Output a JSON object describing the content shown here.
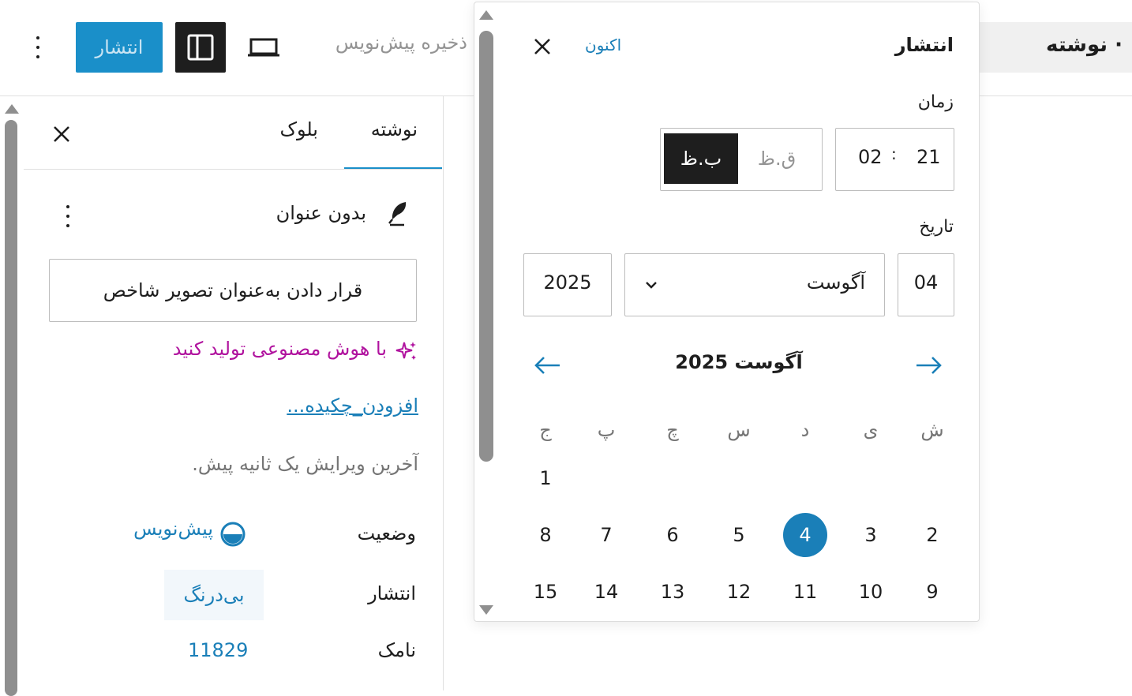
{
  "header": {
    "doc_label": "· نوشته",
    "save_draft": "ذخیره پیش‌نویس",
    "publish_button": "انتشار",
    "accent_color": "#1a8fc9"
  },
  "sidebar": {
    "tabs": [
      {
        "label": "نوشته",
        "active": true
      },
      {
        "label": "بلوک",
        "active": false
      }
    ],
    "post_title": "بدون عنوان",
    "featured_image_button": "قرار دادن به‌عنوان تصویر شاخص",
    "ai_generate_link": "با هوش مصنوعی تولید کنید",
    "ai_color": "#b0129e",
    "excerpt_link": "افزودن_چکیده...",
    "last_edited": "آخرین ویرایش یک ثانیه پیش.",
    "rows": {
      "status_label": "وضعیت",
      "status_value": "پیش‌نویس",
      "publish_label": "انتشار",
      "publish_value": "بی‌درنگ",
      "slug_label": "نامک",
      "slug_value": "11829"
    }
  },
  "popover": {
    "title": "انتشار",
    "now_link": "اکنون",
    "time_label": "زمان",
    "time": {
      "hour": "21",
      "minute": "02",
      "separator": ":"
    },
    "ampm": {
      "am": "ق.ظ",
      "pm": "ب.ظ",
      "selected": "pm"
    },
    "date_label": "تاریخ",
    "date": {
      "day": "04",
      "month": "آگوست",
      "year": "2025"
    },
    "calendar": {
      "heading": "آگوست 2025",
      "weekdays": [
        "ش",
        "ی",
        "د",
        "س",
        "چ",
        "پ",
        "ج"
      ],
      "weeks": [
        [
          "",
          "",
          "",
          "",
          "",
          "",
          "1"
        ],
        [
          "2",
          "3",
          "4",
          "5",
          "6",
          "7",
          "8"
        ],
        [
          "9",
          "10",
          "11",
          "12",
          "13",
          "14",
          "15"
        ]
      ],
      "selected_day": "4"
    }
  }
}
